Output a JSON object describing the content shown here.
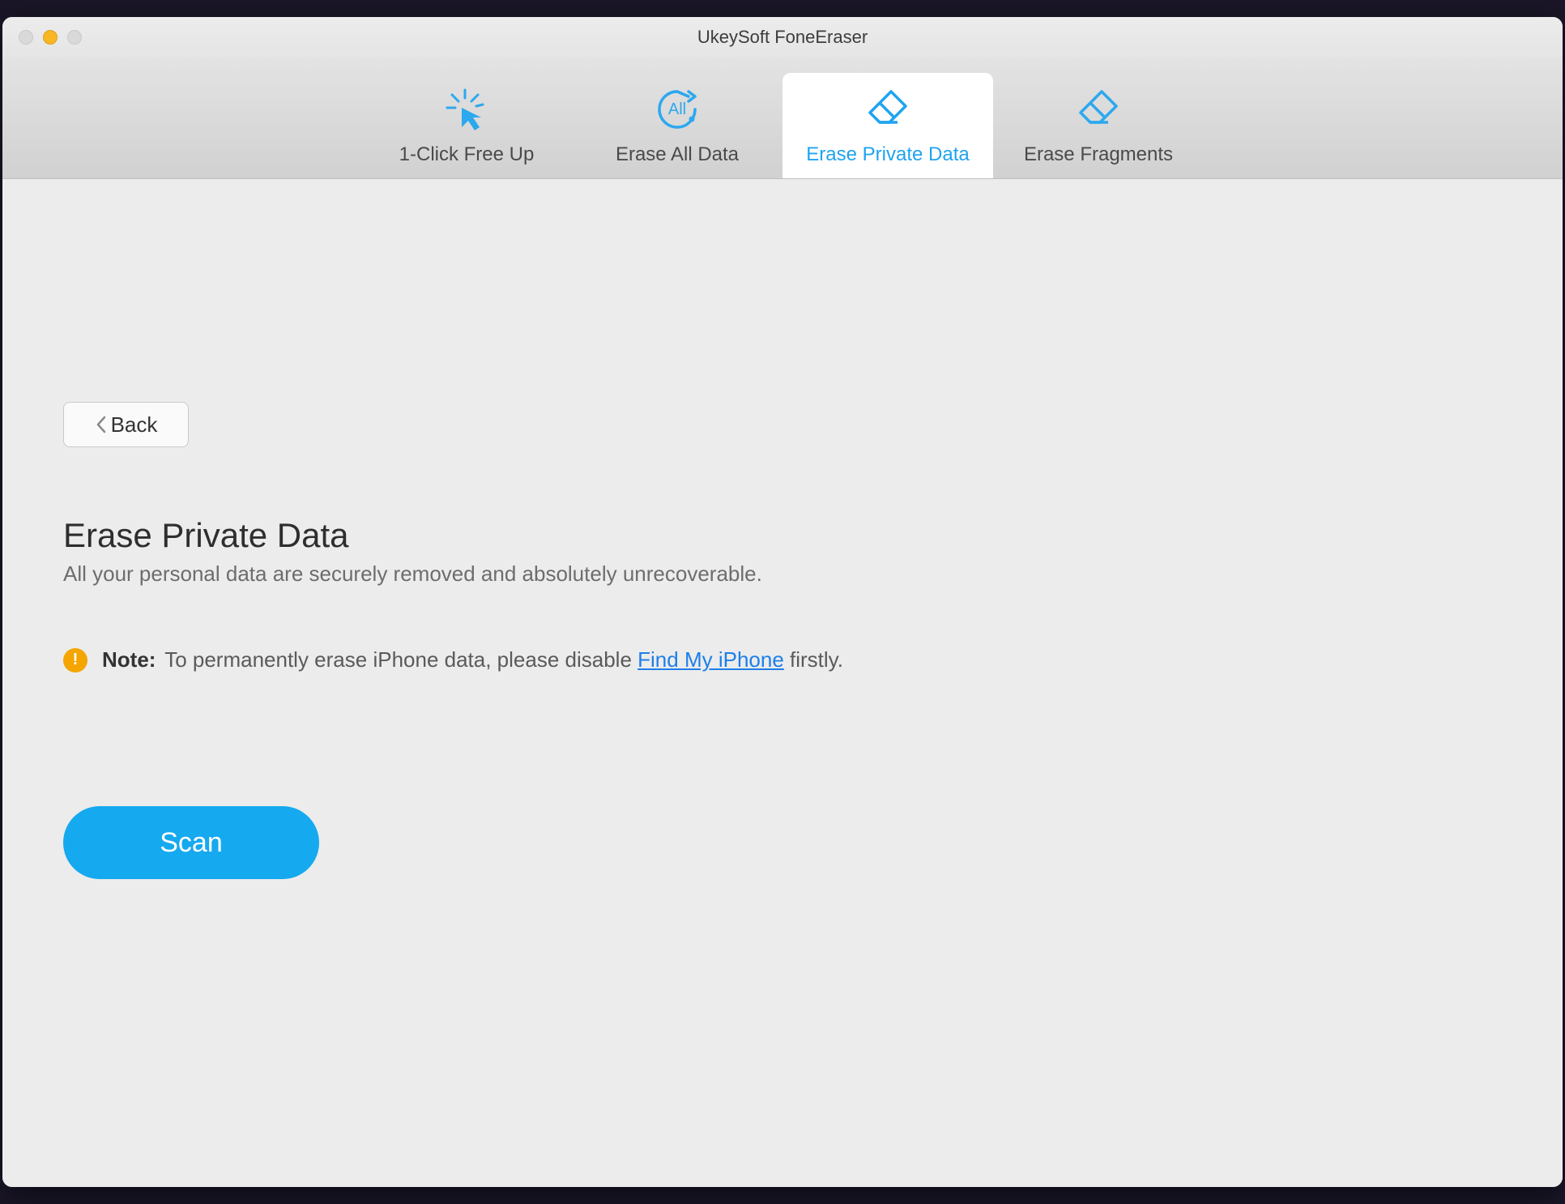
{
  "window": {
    "title": "UkeySoft FoneEraser"
  },
  "tabs": [
    {
      "label": "1-Click Free Up",
      "icon": "cursor-spark-icon",
      "active": false
    },
    {
      "label": "Erase All Data",
      "icon": "clock-all-icon",
      "active": false
    },
    {
      "label": "Erase Private Data",
      "icon": "eraser-icon",
      "active": true
    },
    {
      "label": "Erase Fragments",
      "icon": "eraser-icon",
      "active": false
    }
  ],
  "back": {
    "label": "Back"
  },
  "page": {
    "heading": "Erase Private Data",
    "sub": "All your personal data are securely removed and absolutely unrecoverable."
  },
  "note": {
    "label": "Note:",
    "prefix": "To permanently erase iPhone data, please disable ",
    "link": "Find My iPhone",
    "suffix": " firstly."
  },
  "scan": {
    "label": "Scan"
  },
  "colors": {
    "accent": "#15a9ef",
    "link": "#1e7fe8",
    "warning": "#f4a500"
  }
}
